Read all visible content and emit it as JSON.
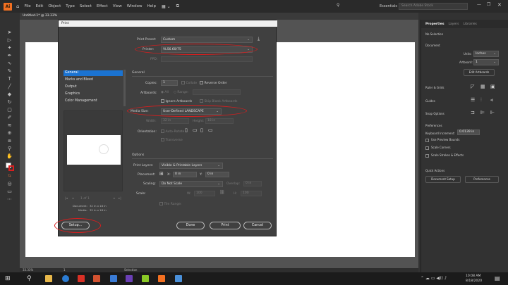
{
  "app": {
    "logo": "Ai",
    "menus": [
      "File",
      "Edit",
      "Object",
      "Type",
      "Select",
      "Effect",
      "View",
      "Window",
      "Help"
    ],
    "workspace": "Essentials",
    "search_placeholder": "Search Adobe Stock",
    "document_tab": "Untitled-1* @ 33.33%"
  },
  "dialog": {
    "title": "Print",
    "print_preset_label": "Print Preset:",
    "print_preset_value": "Custom",
    "printer_label": "Printer:",
    "printer_value": "VLS6.60/75",
    "ppd_label": "PPD:",
    "categories": [
      "General",
      "Marks and Bleed",
      "Output",
      "Graphics",
      "Color Management"
    ],
    "section_general": "General",
    "copies_label": "Copies:",
    "copies_value": "1",
    "collate_label": "Collate",
    "reverse_order_label": "Reverse Order",
    "artboards_label": "Artboards:",
    "all_label": "All",
    "range_label": "Range:",
    "ignore_artboards_label": "Ignore Artboards",
    "skip_blank_label": "Skip Blank Artboards",
    "media_size_label": "Media Size:",
    "media_size_value": "User-Defined LANDSCAPE",
    "width_label": "Width:",
    "width_value": "32 in",
    "height_label": "Height:",
    "height_value": "18 in",
    "orientation_label": "Orientation:",
    "auto_rotate_label": "Auto-Rotate",
    "transverse_label": "Transverse",
    "section_options": "Options",
    "print_layers_label": "Print Layers:",
    "print_layers_value": "Visible & Printable Layers",
    "placement_label": "Placement:",
    "x_label": "X:",
    "x_value": "0 in",
    "y_label": "Y:",
    "y_value": "0 in",
    "scaling_label": "Scaling:",
    "scaling_value": "Do Not Scale",
    "overlap_label": "Overlap:",
    "overlap_value": "0 in",
    "scale_label": "Scale:",
    "w_label": "W:",
    "w_value": "100",
    "h_label": "H:",
    "h_value": "100",
    "tile_range_label": "Tile Range:",
    "page_indicator": "1 of 1",
    "document_label": "Document:",
    "document_value": "32 in x 18 in",
    "media_label": "Media:",
    "media_value": "32 in x 18 in",
    "setup_button": "Setup...",
    "done_button": "Done",
    "print_button": "Print",
    "cancel_button": "Cancel"
  },
  "properties": {
    "tabs": [
      "Properties",
      "Layers",
      "Libraries"
    ],
    "no_selection": "No Selection",
    "document_heading": "Document",
    "units_label": "Units:",
    "units_value": "Inches",
    "artboard_label": "Artboard:",
    "artboard_value": "1",
    "edit_artboards": "Edit Artboards",
    "ruler_grids": "Ruler & Grids",
    "guides": "Guides",
    "snap_options": "Snap Options",
    "preferences_heading": "Preferences",
    "keyboard_increment_label": "Keyboard Increment:",
    "keyboard_increment_value": "0.0139 in",
    "use_preview_bounds": "Use Preview Bounds",
    "scale_corners": "Scale Corners",
    "scale_strokes_effects": "Scale Strokes & Effects",
    "quick_actions": "Quick Actions",
    "document_setup_btn": "Document Setup",
    "preferences_btn": "Preferences"
  },
  "status": {
    "zoom": "33.33%",
    "artboard_num": "1",
    "tool": "Selection"
  },
  "taskbar": {
    "time": "10:08 AM",
    "date": "8/18/2020"
  },
  "colors": {
    "annotation_red": "#d81e1e",
    "selection_blue": "#1b73d1",
    "ai_orange": "#f37021"
  }
}
